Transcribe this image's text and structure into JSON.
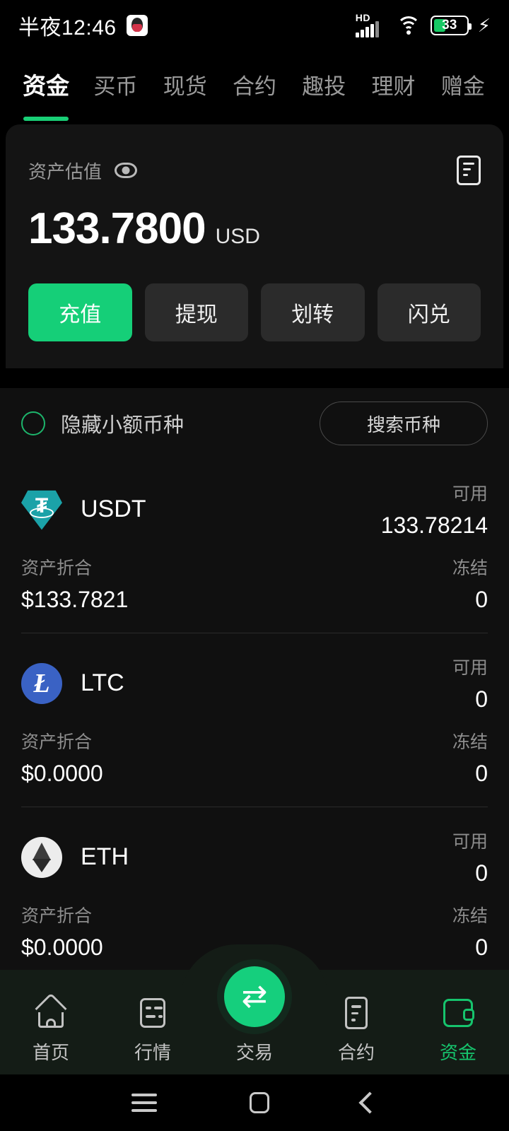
{
  "status_bar": {
    "time": "半夜12:46",
    "app_icon": "qq-icon",
    "network_type": "HD",
    "battery_percent": "33",
    "charging": true
  },
  "top_tabs": [
    {
      "label": "资金",
      "active": true
    },
    {
      "label": "买币",
      "active": false
    },
    {
      "label": "现货",
      "active": false
    },
    {
      "label": "合约",
      "active": false
    },
    {
      "label": "趣投",
      "active": false
    },
    {
      "label": "理财",
      "active": false
    },
    {
      "label": "赠金",
      "active": false
    }
  ],
  "asset_card": {
    "label": "资产估值",
    "eye_icon": "eye-icon",
    "records_icon": "document-icon",
    "balance": "133.7800",
    "currency": "USD",
    "actions": [
      {
        "label": "充值",
        "primary": true
      },
      {
        "label": "提现",
        "primary": false
      },
      {
        "label": "划转",
        "primary": false
      },
      {
        "label": "闪兑",
        "primary": false
      }
    ]
  },
  "filter": {
    "hide_small_label": "隐藏小额币种",
    "hide_small_checked": false,
    "search_label": "搜索币种"
  },
  "list_headers": {
    "available": "可用",
    "frozen": "冻结",
    "converted": "资产折合"
  },
  "coins": [
    {
      "symbol": "USDT",
      "icon": "usdt-icon",
      "available_label": "可用",
      "available": "133.78214",
      "converted_label": "资产折合",
      "converted": "$133.7821",
      "frozen_label": "冻结",
      "frozen": "0"
    },
    {
      "symbol": "LTC",
      "icon": "ltc-icon",
      "available_label": "可用",
      "available": "0",
      "converted_label": "资产折合",
      "converted": "$0.0000",
      "frozen_label": "冻结",
      "frozen": "0"
    },
    {
      "symbol": "ETH",
      "icon": "eth-icon",
      "available_label": "可用",
      "available": "0",
      "converted_label": "资产折合",
      "converted": "$0.0000",
      "frozen_label": "冻结",
      "frozen": "0"
    }
  ],
  "bottom_nav": [
    {
      "label": "首页",
      "icon": "home-icon",
      "active": false
    },
    {
      "label": "行情",
      "icon": "market-icon",
      "active": false
    },
    {
      "label": "交易",
      "icon": "swap-icon",
      "active": false
    },
    {
      "label": "合约",
      "icon": "contract-icon",
      "active": false
    },
    {
      "label": "资金",
      "icon": "wallet-icon",
      "active": true
    }
  ],
  "system_nav": {
    "recents": "recents-icon",
    "home": "home-square-icon",
    "back": "back-chevron-icon"
  },
  "colors": {
    "accent_green": "#15cf7d",
    "card_bg": "#141414",
    "page_bg": "#000000",
    "nav_bg": "#141c16"
  }
}
